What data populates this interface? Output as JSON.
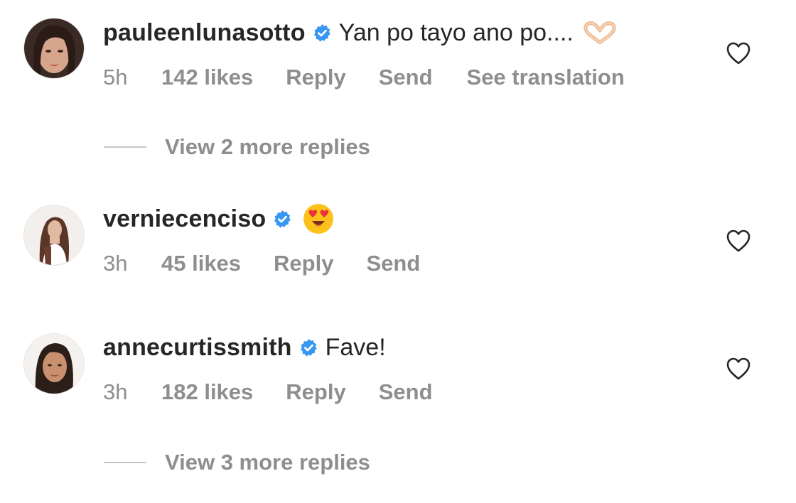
{
  "comments": [
    {
      "username": "pauleenlunasotto",
      "verified": true,
      "text": "Yan po tayo ano po....",
      "emoji": "heart-hands",
      "time": "5h",
      "likes": "142 likes",
      "reply_label": "Reply",
      "send_label": "Send",
      "translate_label": "See translation",
      "view_replies": "View 2 more replies"
    },
    {
      "username": "verniecenciso",
      "verified": true,
      "text": "",
      "emoji": "heart-eyes",
      "time": "3h",
      "likes": "45 likes",
      "reply_label": "Reply",
      "send_label": "Send"
    },
    {
      "username": "annecurtissmith",
      "verified": true,
      "text": "Fave!",
      "time": "3h",
      "likes": "182 likes",
      "reply_label": "Reply",
      "send_label": "Send",
      "view_replies": "View 3 more replies"
    }
  ],
  "colors": {
    "text": "#262626",
    "secondary": "#8e8e8e",
    "verified_badge": "#3897f0",
    "divider": "#c7c7c7"
  }
}
